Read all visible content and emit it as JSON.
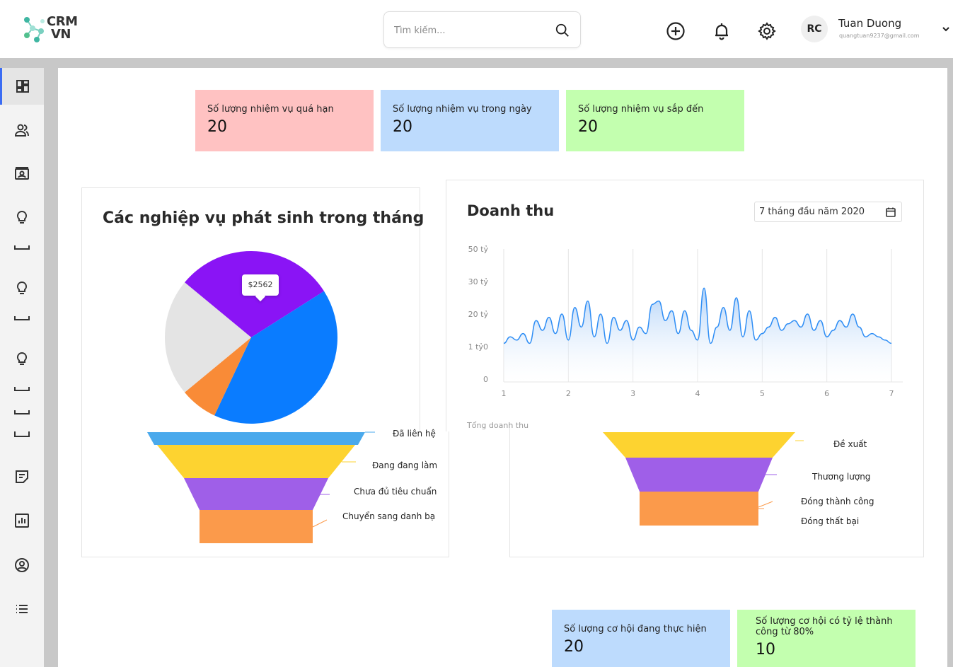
{
  "app": {
    "logo_line1": "CRM",
    "logo_line2": "VN"
  },
  "header": {
    "search_placeholder": "Tìm kiếm...",
    "icons": [
      "add-circle-icon",
      "bell-icon",
      "gear-icon"
    ],
    "user": {
      "initials": "RC",
      "name": "Tuan Duong",
      "email": "quangtuan9237@gmail.com"
    }
  },
  "sidebar": {
    "items": [
      "dashboard-icon",
      "contacts-icon",
      "contact-card-icon",
      "lightbulb-icon",
      "lightbulb-icon",
      "lightbulb-icon",
      "notes-icon",
      "report-chart-icon",
      "user-circle-icon",
      "list-icon"
    ],
    "active_index": 0
  },
  "stats_top": [
    {
      "label": "Số lượng nhiệm vụ quá hạn",
      "value": "20",
      "color": "#ffc2c2"
    },
    {
      "label": "Số lượng nhiệm vụ trong ngày",
      "value": "20",
      "color": "#bddbfd"
    },
    {
      "label": "Số lượng nhiệm vụ sắp đến",
      "value": "20",
      "color": "#c3ffaf"
    }
  ],
  "pie_panel": {
    "title": "Các nghiệp vụ phát sinh trong tháng",
    "tooltip": "$2562"
  },
  "revenue_panel": {
    "title": "Doanh thu",
    "date_range": "7 tháng đầu năm 2020",
    "footer": "Tổng doanh thu"
  },
  "funnel_left": {
    "labels": [
      "Đã liên hệ",
      "Đang đang làm việc",
      "Chưa đủ tiêu chuẩn",
      "Chuyển sang danh bạ"
    ]
  },
  "funnel_right": {
    "labels": [
      "Đề xuất",
      "Thương lượng",
      "Đóng thành công",
      "Đóng thất bại"
    ]
  },
  "stats_bottom": [
    {
      "label": "Số lượng cơ hội đang thực hiện",
      "value": "20",
      "color": "#bddbfd"
    },
    {
      "label": "Số lượng cơ hội có tỷ lệ thành công từ 80%",
      "value": "10",
      "color": "#c3ffaf"
    }
  ],
  "chart_data": [
    {
      "type": "pie",
      "title": "Các nghiệp vụ phát sinh trong tháng",
      "slices": [
        {
          "value": 30,
          "color": "#8a14f5"
        },
        {
          "value": 41,
          "color": "#0a7cff"
        },
        {
          "value": 7,
          "color": "#f98b37"
        },
        {
          "value": 22,
          "color": "#e4e4e4"
        }
      ],
      "annotations": [
        "$2562"
      ]
    },
    {
      "type": "area",
      "title": "Doanh thu",
      "xlabel": "Tổng doanh thu",
      "x_ticks": [
        "1",
        "2",
        "3",
        "4",
        "5",
        "6",
        "7"
      ],
      "y_ticks": [
        "0",
        "1 tỷ0",
        "20 tỷ",
        "30 tỷ",
        "50 tỷ"
      ],
      "xlim": [
        1,
        7
      ],
      "ylim": [
        0,
        4
      ],
      "grid": "vertical",
      "color": "#2f8ef5",
      "series": [
        {
          "x": [
            1.0,
            1.1,
            1.2,
            1.3,
            1.4,
            1.5,
            1.6,
            1.7,
            1.8,
            1.9,
            2.0,
            2.1,
            2.2,
            2.3,
            2.4,
            2.5,
            2.6,
            2.7,
            2.8,
            2.9,
            3.0,
            3.1,
            3.2,
            3.3,
            3.4,
            3.5,
            3.6,
            3.7,
            3.8,
            3.9,
            4.0,
            4.1,
            4.2,
            4.3,
            4.4,
            4.5,
            4.6,
            4.7,
            4.8,
            4.9,
            5.0,
            5.1,
            5.2,
            5.3,
            5.4,
            5.5,
            5.6,
            5.7,
            5.8,
            5.9,
            6.0,
            6.1,
            6.2,
            6.3,
            6.4,
            6.5,
            6.6,
            6.7,
            6.8,
            6.9,
            7.0
          ],
          "y": [
            1.1,
            1.3,
            1.2,
            1.4,
            1.1,
            1.8,
            1.5,
            1.9,
            1.4,
            2.0,
            1.2,
            2.2,
            1.6,
            2.4,
            1.3,
            2.0,
            1.1,
            1.9,
            1.5,
            1.8,
            1.2,
            1.6,
            1.4,
            2.3,
            2.4,
            1.8,
            2.1,
            1.4,
            2.1,
            1.5,
            1.2,
            2.8,
            1.1,
            1.6,
            2.2,
            1.5,
            2.5,
            1.3,
            2.1,
            1.2,
            1.4,
            1.6,
            1.9,
            1.5,
            1.7,
            1.8,
            1.6,
            2.0,
            1.5,
            1.8,
            1.3,
            1.5,
            1.8,
            1.6,
            2.0,
            1.6,
            1.3,
            1.4,
            1.3,
            1.2,
            1.1
          ]
        }
      ]
    },
    {
      "type": "bar",
      "title": "",
      "categories": [
        "Đã liên hệ",
        "Đang đang làm việc",
        "Chưa đủ tiêu chuẩn",
        "Chuyển sang danh bạ"
      ],
      "values": [
        100,
        90,
        58,
        50
      ],
      "colors": [
        "#4aa9ec",
        "#fdd330",
        "#9f5fe8",
        "#fb9a4b"
      ]
    },
    {
      "type": "bar",
      "title": "",
      "categories": [
        "Đề xuất",
        "Thương lượng",
        "Đóng thành công",
        "Đóng thất bại"
      ],
      "values": [
        100,
        70,
        60,
        60
      ],
      "colors": [
        "#fdd330",
        "#9f5fe8",
        "#fb9a4b",
        "#fb9a4b"
      ]
    }
  ]
}
